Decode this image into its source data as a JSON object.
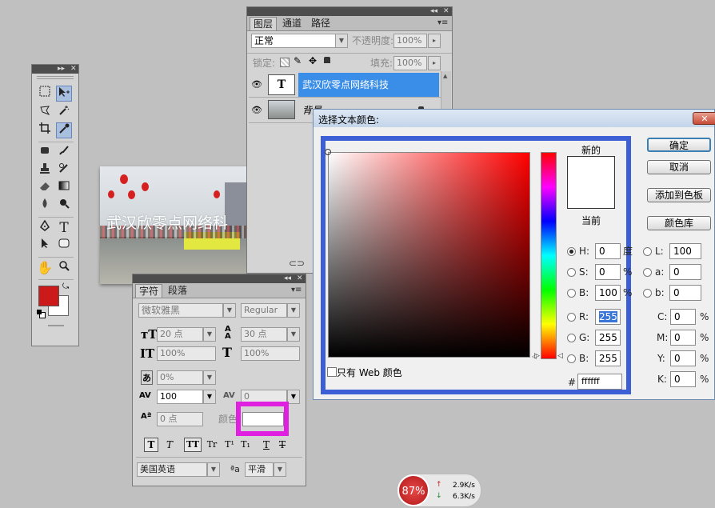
{
  "tools_panel": {
    "title_arrows": "▸▸",
    "close": "✕"
  },
  "layers_panel": {
    "title_arrows": "◂◂",
    "close": "✕",
    "tabs": [
      "图层",
      "通道",
      "路径"
    ],
    "blend_mode": "正常",
    "opacity_label": "不透明度:",
    "opacity_value": "100%",
    "lock_label": "锁定:",
    "fill_label": "填充:",
    "fill_value": "100%",
    "layers": [
      {
        "thumb": "T",
        "name": "武汉欣零点网络科技",
        "selected": true
      },
      {
        "name": "背景",
        "selected": false
      }
    ]
  },
  "canvas": {
    "overlay_text": "武汉欣零点网络科"
  },
  "char_panel": {
    "title_arrows": "◂◂",
    "close": "✕",
    "tabs": [
      "字符",
      "段落"
    ],
    "font_family": "微软雅黑",
    "font_style": "Regular",
    "font_size": "20 点",
    "leading": "30 点",
    "vertical_scale": "100%",
    "horizontal_scale": "100%",
    "tsume": "0%",
    "tracking": "100",
    "kerning": "0",
    "baseline_shift": "0 点",
    "color_label": "颜色:",
    "style_buttons": [
      "T",
      "T",
      "TT",
      "Tr",
      "T¹",
      "T₁",
      "T",
      "T"
    ],
    "language": "美国英语",
    "aa_label": "ªa",
    "antialias": "平滑"
  },
  "color_dialog": {
    "title": "选择文本颜色:",
    "close": "✕",
    "new_label": "新的",
    "current_label": "当前",
    "buttons": {
      "ok": "确定",
      "cancel": "取消",
      "add_swatch": "添加到色板",
      "libraries": "颜色库"
    },
    "web_only_label": "只有 Web 颜色",
    "hsb": [
      {
        "label": "H:",
        "value": "0",
        "unit": "度"
      },
      {
        "label": "S:",
        "value": "0",
        "unit": "%"
      },
      {
        "label": "B:",
        "value": "100",
        "unit": "%"
      }
    ],
    "rgb": [
      {
        "label": "R:",
        "value": "255"
      },
      {
        "label": "G:",
        "value": "255"
      },
      {
        "label": "B:",
        "value": "255"
      }
    ],
    "hex_label": "#",
    "hex_value": "ffffff",
    "lab": [
      {
        "label": "L:",
        "value": "100"
      },
      {
        "label": "a:",
        "value": "0"
      },
      {
        "label": "b:",
        "value": "0"
      }
    ],
    "cmyk": [
      {
        "label": "C:",
        "value": "0",
        "unit": "%"
      },
      {
        "label": "M:",
        "value": "0",
        "unit": "%"
      },
      {
        "label": "Y:",
        "value": "0",
        "unit": "%"
      },
      {
        "label": "K:",
        "value": "0",
        "unit": "%"
      }
    ]
  },
  "net_widget": {
    "percent": "87%",
    "up": "2.9K/s",
    "down": "6.3K/s"
  },
  "colors": {
    "highlight_blue": "#3c5fd6",
    "magenta": "#e020e0",
    "layer_selected": "#3b8ee8",
    "foreground": "#cc1a1a"
  }
}
